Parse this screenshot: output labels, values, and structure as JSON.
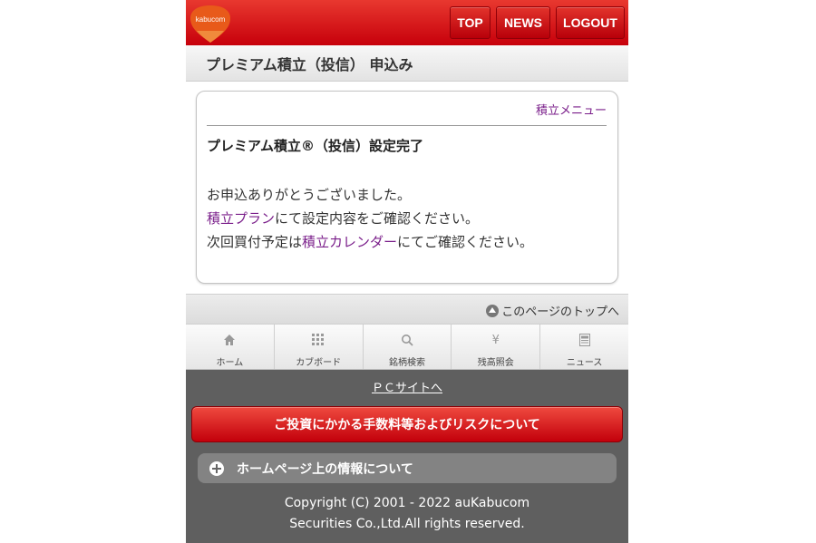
{
  "header": {
    "logo_text": "kabucom",
    "nav": {
      "top": "TOP",
      "news": "NEWS",
      "logout": "LOGOUT"
    }
  },
  "page_title": "プレミアム積立（投信） 申込み",
  "card": {
    "menu_link": "積立メニュー",
    "heading": "プレミアム積立®（投信）設定完了",
    "line1": "お申込ありがとうございました。",
    "line2_link": "積立プラン",
    "line2_text": "にて設定内容をご確認ください。",
    "line3_prefix": "次回買付予定は",
    "line3_link": "積立カレンダー",
    "line3_text": "にてご確認ください。"
  },
  "page_top": "このページのトップへ",
  "tabs": [
    {
      "label": "ホーム",
      "icon": "home-icon"
    },
    {
      "label": "カブボード",
      "icon": "grid-icon"
    },
    {
      "label": "銘柄検索",
      "icon": "search-icon"
    },
    {
      "label": "残高照会",
      "icon": "yen-icon"
    },
    {
      "label": "ニュース",
      "icon": "news-icon"
    }
  ],
  "footer": {
    "pc_site": "ＰＣサイトへ",
    "risk_button": "ご投資にかかる手数料等およびリスクについて",
    "info_bar": "ホームページ上の情報について",
    "copyright_line1": "Copyright (C) 2001 - 2022 auKabucom",
    "copyright_line2": "Securities Co.,Ltd.All rights reserved."
  },
  "colors": {
    "brand_red": "#c7000b",
    "link_purple": "#7a1e8a",
    "footer_gray": "#5f5f5f",
    "logo_orange": "#e85a1a"
  }
}
